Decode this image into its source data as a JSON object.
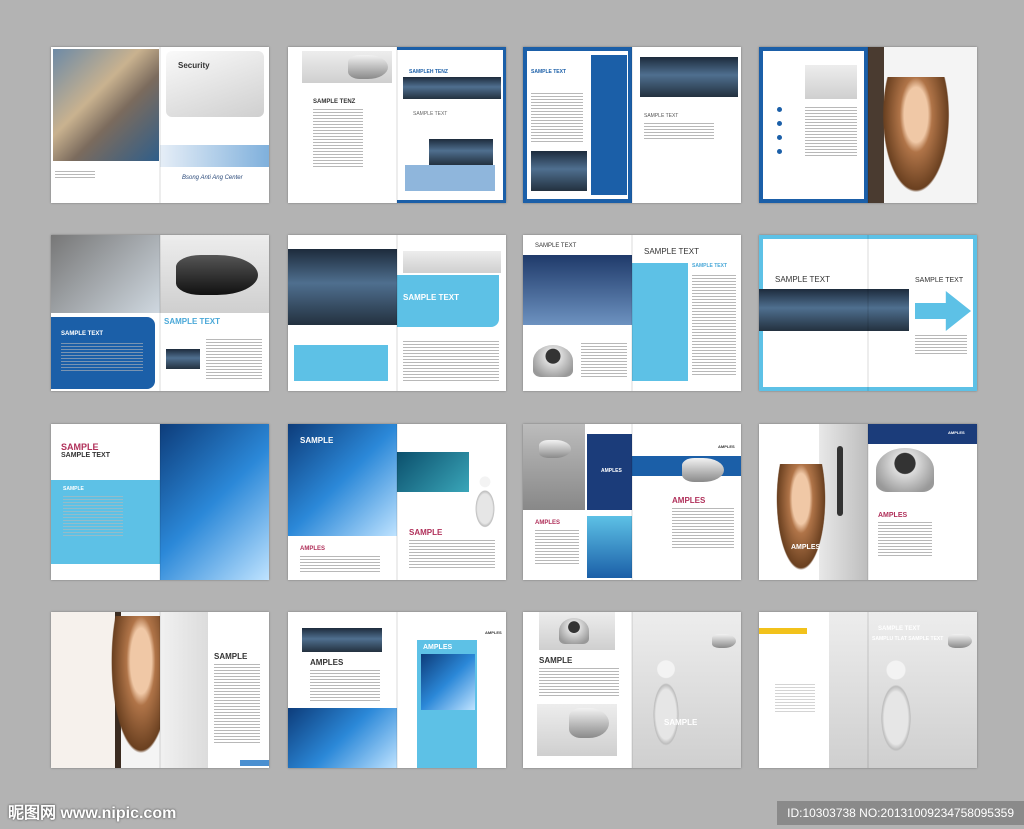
{
  "spreads": [
    {
      "kind": "cover",
      "labels": [
        "Security",
        "Bsong Anti Ang Center"
      ]
    },
    {
      "kind": "text",
      "labels": [
        "SAMPLE TENZ",
        "SAMPLEH TENZ",
        "SAMPLE TEXT"
      ]
    },
    {
      "kind": "text",
      "labels": [
        "SAMPLE TEXT",
        "SAMPLE TEXT"
      ]
    },
    {
      "kind": "girl",
      "labels": []
    },
    {
      "kind": "camera",
      "labels": [
        "SAMPLE TEXT",
        "SAMPLE TEXT"
      ]
    },
    {
      "kind": "control",
      "labels": [
        "SAMPLE TEXT"
      ]
    },
    {
      "kind": "control2",
      "labels": [
        "SAMPLE TEXT",
        "SAMPLE TEXT",
        "SAMPLE TEXT"
      ]
    },
    {
      "kind": "arrow",
      "labels": [
        "SAMPLE TEXT",
        "SAMPLE TEXT"
      ]
    },
    {
      "kind": "tech",
      "labels": [
        "SAMPLE",
        "SAMPLE TEXT",
        "SAMPLE"
      ]
    },
    {
      "kind": "tech2",
      "labels": [
        "SAMPLE",
        "AMPLES",
        "SAMPLE"
      ]
    },
    {
      "kind": "amples",
      "labels": [
        "AMPLES",
        "AMPLES",
        "AMPLES",
        "AMPLES"
      ]
    },
    {
      "kind": "door",
      "labels": [
        "AMPLES",
        "AMPLES",
        "AMPLES"
      ]
    },
    {
      "kind": "girl2",
      "labels": [
        "SAMPLE"
      ]
    },
    {
      "kind": "amples2",
      "labels": [
        "AMPLES",
        "AMPLES",
        "AMPLES"
      ]
    },
    {
      "kind": "cams",
      "labels": [
        "SAMPLE",
        "SAMPLE"
      ]
    },
    {
      "kind": "man",
      "labels": [
        "SAMPLE TEXT",
        "SAMPLU TLAT SAMPLE TEXT",
        "SAMPLE TEXT"
      ]
    }
  ],
  "footer": {
    "logo": "昵图网 www.nipic.com",
    "id": "ID:10303738 NO:20131009234758095359"
  }
}
